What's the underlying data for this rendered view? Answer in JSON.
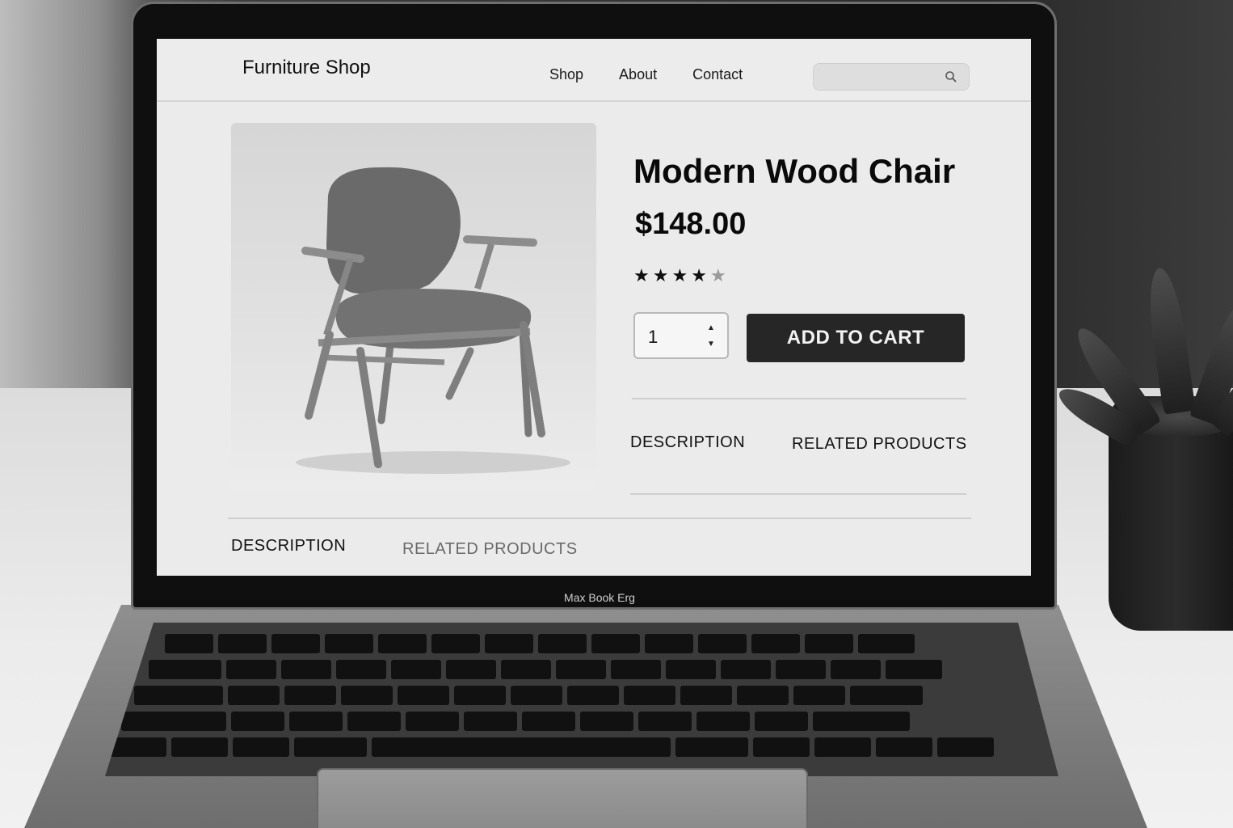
{
  "device": {
    "brand_label": "Max Book Erg"
  },
  "site": {
    "logo": "Furniture Shop",
    "nav": [
      "Shop",
      "About",
      "Contact"
    ],
    "search": {
      "placeholder": ""
    }
  },
  "product": {
    "title": "Modern Wood Chair",
    "price": "$148.00",
    "rating": {
      "value": 4,
      "max": 5
    },
    "quantity": "1",
    "add_to_cart_label": "ADD TO CART"
  },
  "tabs_upper": [
    "DESCRIPTION",
    "RELATED PRODUCTS"
  ],
  "tabs_lower": [
    "DESCRIPTION",
    "RELATED PRODUCTS"
  ],
  "colors": {
    "button_bg": "#262626",
    "screen_bg": "#ebebeb"
  }
}
